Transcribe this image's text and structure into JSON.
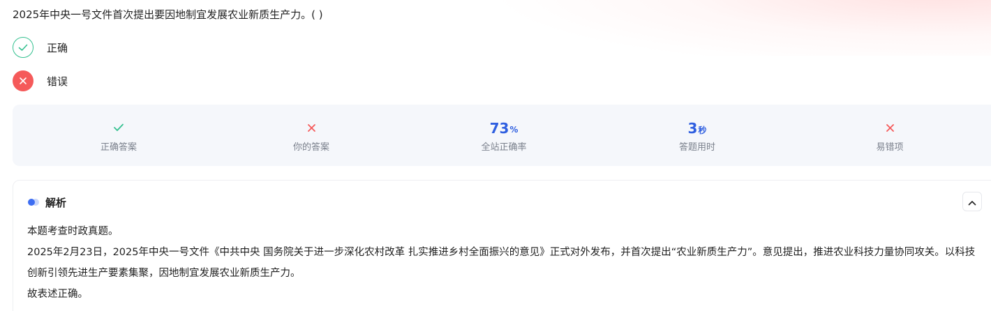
{
  "question": {
    "text": "2025年中央一号文件首次提出要因地制宜发展农业新质生产力。( )"
  },
  "options": [
    {
      "label": "正确",
      "state": "correct",
      "icon": "check-icon"
    },
    {
      "label": "错误",
      "state": "selected-wrong",
      "icon": "close-icon"
    }
  ],
  "stats": {
    "correct_answer": {
      "label": "正确答案",
      "icon": "check-icon"
    },
    "your_answer": {
      "label": "你的答案",
      "icon": "close-icon"
    },
    "accuracy": {
      "value": "73",
      "unit": "%",
      "label": "全站正确率"
    },
    "time_used": {
      "value": "3",
      "unit": "秒",
      "label": "答题用时"
    },
    "error_prone": {
      "label": "易错项",
      "icon": "close-icon"
    }
  },
  "analysis": {
    "title": "解析",
    "collapse_icon": "chevron-up-icon",
    "paragraphs": [
      "本题考查时政真题。",
      "2025年2月23日，2025年中央一号文件《中共中央 国务院关于进一步深化农村改革 扎实推进乡村全面振兴的意见》正式对外发布，并首次提出“农业新质生产力”。意见提出，推进农业科技力量协同攻关。以科技创新引领先进生产要素集聚，因地制宜发展农业新质生产力。",
      "故表述正确。"
    ]
  },
  "colors": {
    "correct_green": "#33c08f",
    "wrong_red": "#f55a5a",
    "accent_blue": "#2f5fe0",
    "stats_bg": "#f5f7fb"
  }
}
